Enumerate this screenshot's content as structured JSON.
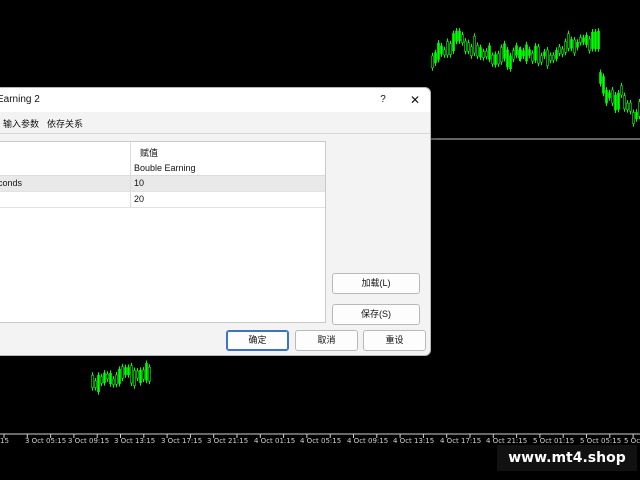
{
  "colors": {
    "candle": "#00ff00",
    "background": "#000000",
    "grid_line": "#c8c8c8"
  },
  "chart": {
    "time_labels": [
      "15",
      "3 Oct 05:15",
      "3 Oct 09:15",
      "3 Oct 13:15",
      "3 Oct 17:15",
      "3 Oct 21:15",
      "4 Oct 01:15",
      "4 Oct 05:15",
      "4 Oct 09:15",
      "4 Oct 13:15",
      "4 Oct 17:15",
      "4 Oct 21:15",
      "5 Oct 01:15",
      "5 Oct 05:15",
      "5 Oct"
    ]
  },
  "watermark": "www.mt4.shop",
  "dialog": {
    "title": "Earning 2",
    "help": "?",
    "close": "✕",
    "tabs": [
      "输入参数",
      "依存关系"
    ],
    "grid": {
      "value_header": "赋值",
      "rows": [
        {
          "name": "",
          "value": "Bouble Earning"
        },
        {
          "name": "conds",
          "value": "10"
        },
        {
          "name": "",
          "value": "20"
        }
      ]
    },
    "load_button": "加载(L)",
    "save_button": "保存(S)",
    "ok_button": "确定",
    "cancel_button": "取消",
    "reset_button": "重设"
  }
}
